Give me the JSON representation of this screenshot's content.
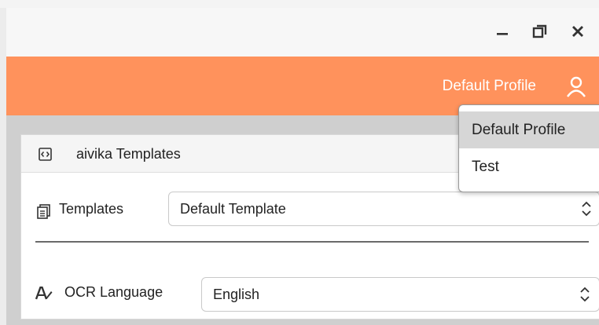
{
  "window": {
    "controls": {
      "minimize_icon": "minimize-icon",
      "restore_icon": "restore-icon",
      "close_icon": "close-icon"
    }
  },
  "profile_bar": {
    "current_profile": "Default Profile",
    "user_icon": "user-icon",
    "accent_color": "#ff925c"
  },
  "profile_dropdown": {
    "items": [
      {
        "label": "Default Profile",
        "selected": true
      },
      {
        "label": "Test",
        "selected": false
      }
    ]
  },
  "card": {
    "title": "aivika Templates",
    "title_icon": "template-code-icon",
    "templates": {
      "label": "Templates",
      "icon": "templates-icon",
      "value": "Default Template"
    },
    "ocr": {
      "label": "OCR Language",
      "icon": "ocr-language-icon",
      "value": "English"
    }
  }
}
